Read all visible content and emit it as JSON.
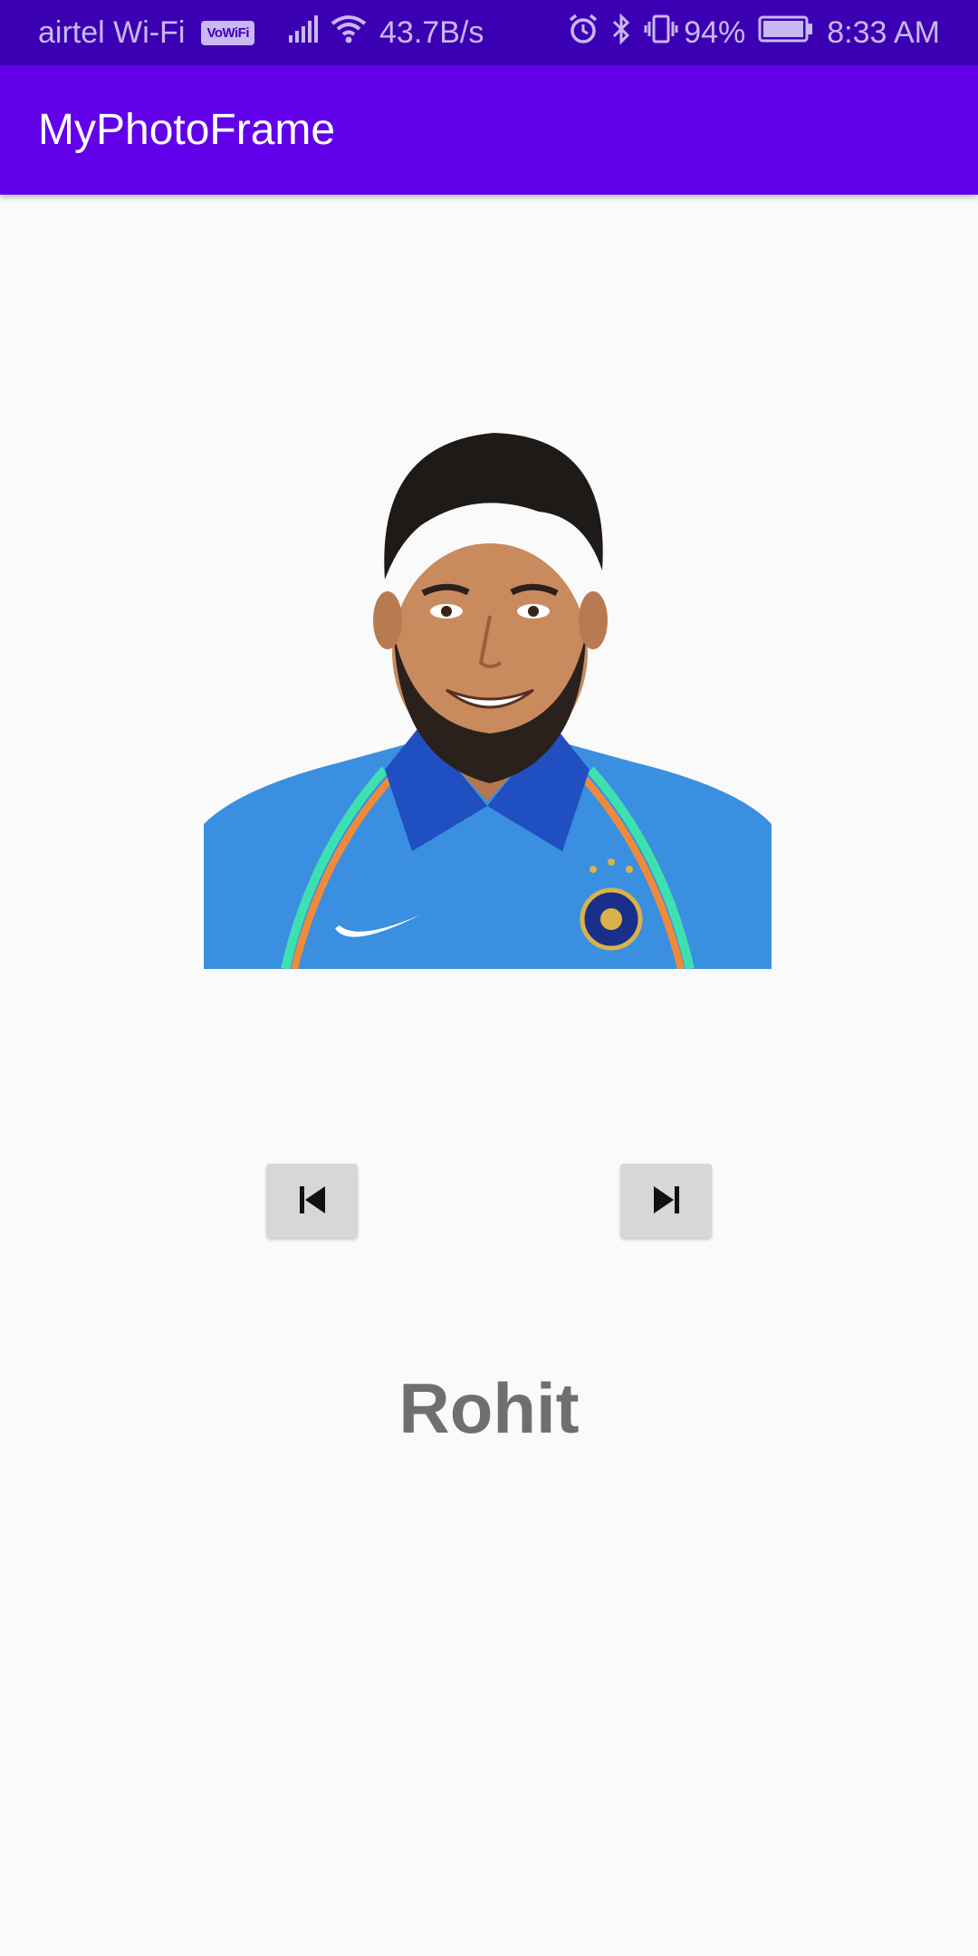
{
  "status_bar": {
    "carrier": "airtel Wi-Fi",
    "vowifi": "VoWiFi",
    "network_speed": "43.7B/s",
    "battery": "94%",
    "time": "8:33 AM"
  },
  "app_bar": {
    "title": "MyPhotoFrame"
  },
  "photo": {
    "jersey_color": "#3a8fe0",
    "collar_color": "#1f4fc0",
    "skin_color": "#c98a5e",
    "hair_color": "#1e1a18"
  },
  "controls": {
    "previous_icon": "skip-previous-icon",
    "next_icon": "skip-next-icon"
  },
  "caption": {
    "name": "Rohit"
  },
  "colors": {
    "status_bar": "#3b00b3",
    "app_bar": "#6200ea",
    "background": "#fafafa",
    "button": "#d6d7d7",
    "name_text": "#6f6f6f"
  }
}
